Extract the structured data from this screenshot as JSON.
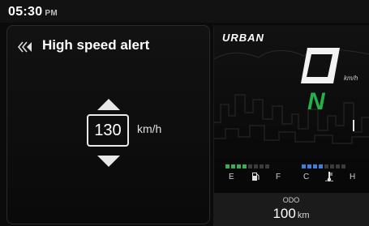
{
  "status_bar": {
    "time": "05:30",
    "ampm": "PM"
  },
  "alert_panel": {
    "title": "High speed alert",
    "value": "130",
    "unit": "km/h",
    "back_icon": "double-chevron-left-icon",
    "up_icon": "triangle-up-icon",
    "down_icon": "triangle-down-icon"
  },
  "cluster": {
    "mode": "URBAN",
    "speed_unit": "km/h",
    "gear": "N",
    "speed_digit_shape": "zero-outline",
    "fuel_gauge": {
      "left_label": "E",
      "right_label": "F",
      "segments_total": 8,
      "segments_filled": 4,
      "color": "#3eac55",
      "icon": "fuel-pump-icon"
    },
    "temp_gauge": {
      "left_label": "C",
      "right_label": "H",
      "segments_total": 8,
      "segments_filled": 4,
      "color": "#3d7fd6",
      "icon": "thermometer-icon"
    }
  },
  "odo": {
    "label": "ODO",
    "value": "100",
    "unit": "km"
  },
  "colors": {
    "gear": "#21b24d",
    "background": "#0b0b0b"
  }
}
